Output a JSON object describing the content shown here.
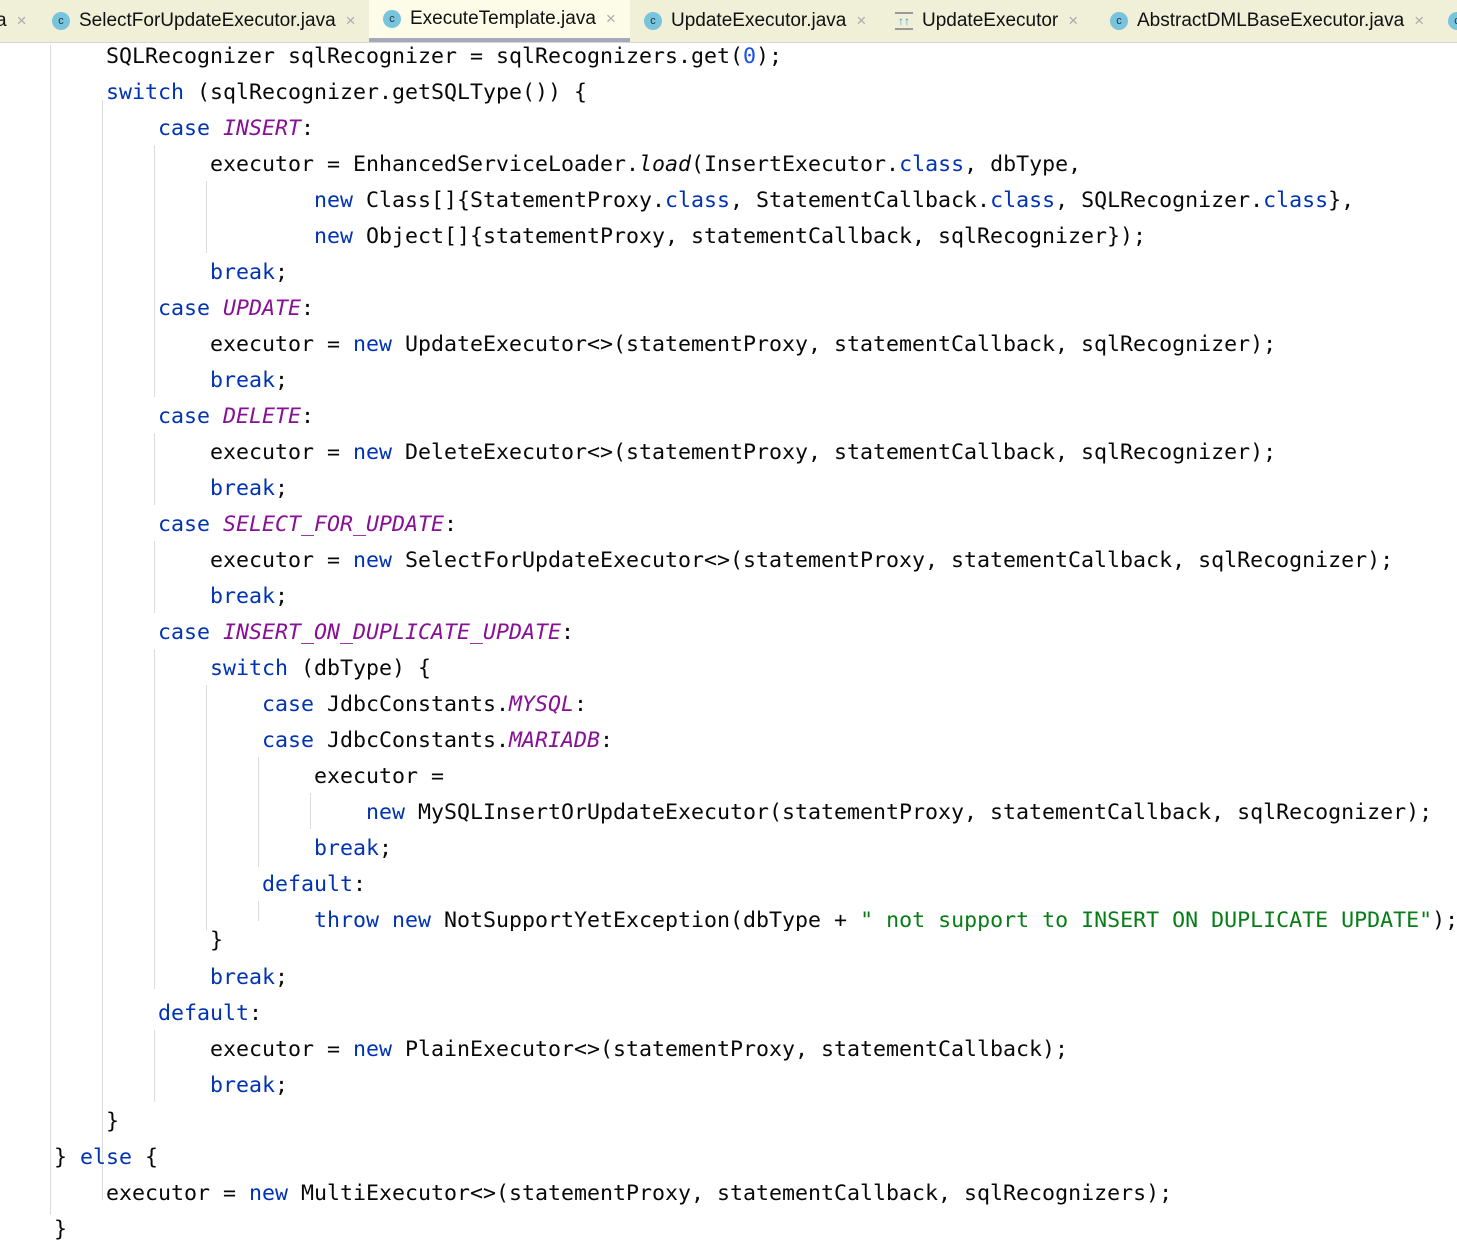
{
  "tabs": [
    {
      "label": "a",
      "icon": "close-icon"
    },
    {
      "label": "SelectForUpdateExecutor.java",
      "icon": "class-icon"
    },
    {
      "label": "ExecuteTemplate.java",
      "icon": "class-icon",
      "active": true
    },
    {
      "label": "UpdateExecutor.java",
      "icon": "class-icon"
    },
    {
      "label": "UpdateExecutor",
      "icon": "bytecode-icon"
    },
    {
      "label": "AbstractDMLBaseExecutor.java",
      "icon": "abstract-class-icon"
    }
  ],
  "icons": {
    "class": "c",
    "close": "×",
    "bytecode": "↑↑"
  },
  "colors": {
    "keyword": "#0033b3",
    "constant": "#871094",
    "string": "#067d17",
    "number": "#1750eb"
  },
  "code": {
    "lines": [
      [
        [
          "p",
          "        SQLRecognizer sqlRecognizer = sqlRecognizers.get("
        ],
        [
          "n",
          "0"
        ],
        [
          "p",
          ");"
        ]
      ],
      [
        [
          "k",
          "        switch"
        ],
        [
          "p",
          " (sqlRecognizer.getSQLType()) {"
        ]
      ],
      [
        [
          "k",
          "            case "
        ],
        [
          "e",
          "INSERT"
        ],
        [
          "p",
          ":"
        ]
      ],
      [
        [
          "p",
          "                executor = EnhancedServiceLoader."
        ],
        [
          "i",
          "load"
        ],
        [
          "p",
          "(InsertExecutor."
        ],
        [
          "k",
          "class"
        ],
        [
          "p",
          ", dbType,"
        ]
      ],
      [
        [
          "k",
          "                        new"
        ],
        [
          "p",
          " Class[]{StatementProxy."
        ],
        [
          "k",
          "class"
        ],
        [
          "p",
          ", StatementCallback."
        ],
        [
          "k",
          "class"
        ],
        [
          "p",
          ", SQLRecognizer."
        ],
        [
          "k",
          "class"
        ],
        [
          "p",
          "},"
        ]
      ],
      [
        [
          "k",
          "                        new"
        ],
        [
          "p",
          " Object[]{statementProxy, statementCallback, sqlRecognizer});"
        ]
      ],
      [
        [
          "k",
          "                break"
        ],
        [
          "p",
          ";"
        ]
      ],
      [
        [
          "k",
          "            case "
        ],
        [
          "e",
          "UPDATE"
        ],
        [
          "p",
          ":"
        ]
      ],
      [
        [
          "p",
          "                executor = "
        ],
        [
          "k",
          "new"
        ],
        [
          "p",
          " UpdateExecutor<>(statementProxy, statementCallback, sqlRecognizer);"
        ]
      ],
      [
        [
          "k",
          "                break"
        ],
        [
          "p",
          ";"
        ]
      ],
      [
        [
          "k",
          "            case "
        ],
        [
          "e",
          "DELETE"
        ],
        [
          "p",
          ":"
        ]
      ],
      [
        [
          "p",
          "                executor = "
        ],
        [
          "k",
          "new"
        ],
        [
          "p",
          " DeleteExecutor<>(statementProxy, statementCallback, sqlRecognizer);"
        ]
      ],
      [
        [
          "k",
          "                break"
        ],
        [
          "p",
          ";"
        ]
      ],
      [
        [
          "k",
          "            case "
        ],
        [
          "e",
          "SELECT_FOR_UPDATE"
        ],
        [
          "p",
          ":"
        ]
      ],
      [
        [
          "p",
          "                executor = "
        ],
        [
          "k",
          "new"
        ],
        [
          "p",
          " SelectForUpdateExecutor<>(statementProxy, statementCallback, sqlRecognizer);"
        ]
      ],
      [
        [
          "k",
          "                break"
        ],
        [
          "p",
          ";"
        ]
      ],
      [
        [
          "k",
          "            case "
        ],
        [
          "e",
          "INSERT_ON_DUPLICATE_UPDATE"
        ],
        [
          "p",
          ":"
        ]
      ],
      [
        [
          "k",
          "                switch"
        ],
        [
          "p",
          " (dbType) {"
        ]
      ],
      [
        [
          "k",
          "                    case"
        ],
        [
          "p",
          " JdbcConstants."
        ],
        [
          "e",
          "MYSQL"
        ],
        [
          "p",
          ":"
        ]
      ],
      [
        [
          "k",
          "                    case"
        ],
        [
          "p",
          " JdbcConstants."
        ],
        [
          "e",
          "MARIADB"
        ],
        [
          "p",
          ":"
        ]
      ],
      [
        [
          "p",
          "                        executor ="
        ]
      ],
      [
        [
          "k",
          "                            new"
        ],
        [
          "p",
          " MySQLInsertOrUpdateExecutor(statementProxy, statementCallback, sqlRecognizer);"
        ]
      ],
      [
        [
          "k",
          "                        break"
        ],
        [
          "p",
          ";"
        ]
      ],
      [
        [
          "k",
          "                    default"
        ],
        [
          "p",
          ":"
        ]
      ],
      [
        [
          "k",
          "                        throw new"
        ],
        [
          "p",
          " NotSupportYetException(dbType + "
        ],
        [
          "s",
          "\" not support to INSERT_ON_DUPLICATE_UPDATE\""
        ],
        [
          "p",
          ");"
        ]
      ],
      [
        [
          "p",
          "                }"
        ]
      ],
      [
        [
          "k",
          "                break"
        ],
        [
          "p",
          ";"
        ]
      ],
      [
        [
          "k",
          "            default"
        ],
        [
          "p",
          ":"
        ]
      ],
      [
        [
          "p",
          "                executor = "
        ],
        [
          "k",
          "new"
        ],
        [
          "p",
          " PlainExecutor<>(statementProxy, statementCallback);"
        ]
      ],
      [
        [
          "k",
          "                break"
        ],
        [
          "p",
          ";"
        ]
      ],
      [
        [
          "p",
          "        }"
        ]
      ],
      [
        [
          "p",
          "    } "
        ],
        [
          "k",
          "else"
        ],
        [
          "p",
          " {"
        ]
      ],
      [
        [
          "p",
          "        executor = "
        ],
        [
          "k",
          "new"
        ],
        [
          "p",
          " MultiExecutor<>(statementProxy, statementCallback, sqlRecognizers);"
        ]
      ],
      [
        [
          "p",
          "    }"
        ]
      ]
    ]
  }
}
